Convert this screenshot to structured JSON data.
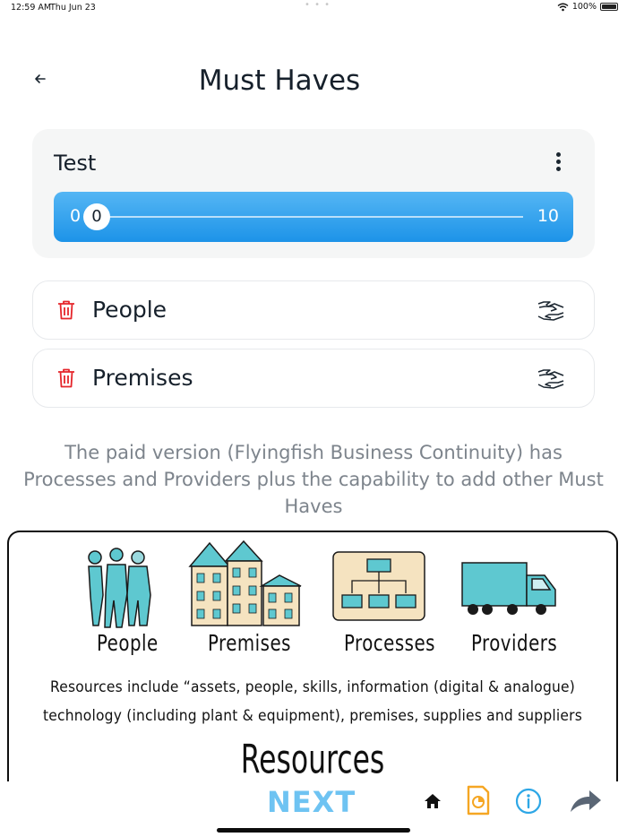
{
  "status_bar": {
    "time": "12:59 AM",
    "date": "Thu Jun 23",
    "battery": "100%"
  },
  "header": {
    "title": "Must Haves"
  },
  "card": {
    "title": "Test",
    "slider": {
      "min": "0",
      "max": "10",
      "value": "0"
    }
  },
  "must_haves": [
    {
      "label": "People"
    },
    {
      "label": "Premises"
    }
  ],
  "info_text": "The paid version (Flyingfish Business Continuity) has Processes and Providers plus the capability to add other Must Haves",
  "resources_image": {
    "labels": [
      "People",
      "Premises",
      "Processes",
      "Providers"
    ],
    "desc_line1": "Resources include “assets, people, skills, information (digital & analogue)",
    "desc_line2": "technology (including plant & equipment), premises, supplies and suppliers",
    "title": "Resources"
  },
  "bottom_bar": {
    "next_label": "NEXT"
  },
  "colors": {
    "accent": "#1d93e8",
    "delete": "#e5262b",
    "next": "#6ec3f2",
    "report": "#f5a623",
    "info": "#2ea7e6",
    "illustration": "#5ec8d0"
  },
  "icons": [
    "back-arrow-icon",
    "kebab-menu-icon",
    "trash-icon",
    "handshake-icon",
    "home-icon",
    "report-icon",
    "info-icon",
    "share-icon",
    "wifi-icon",
    "battery-icon"
  ]
}
